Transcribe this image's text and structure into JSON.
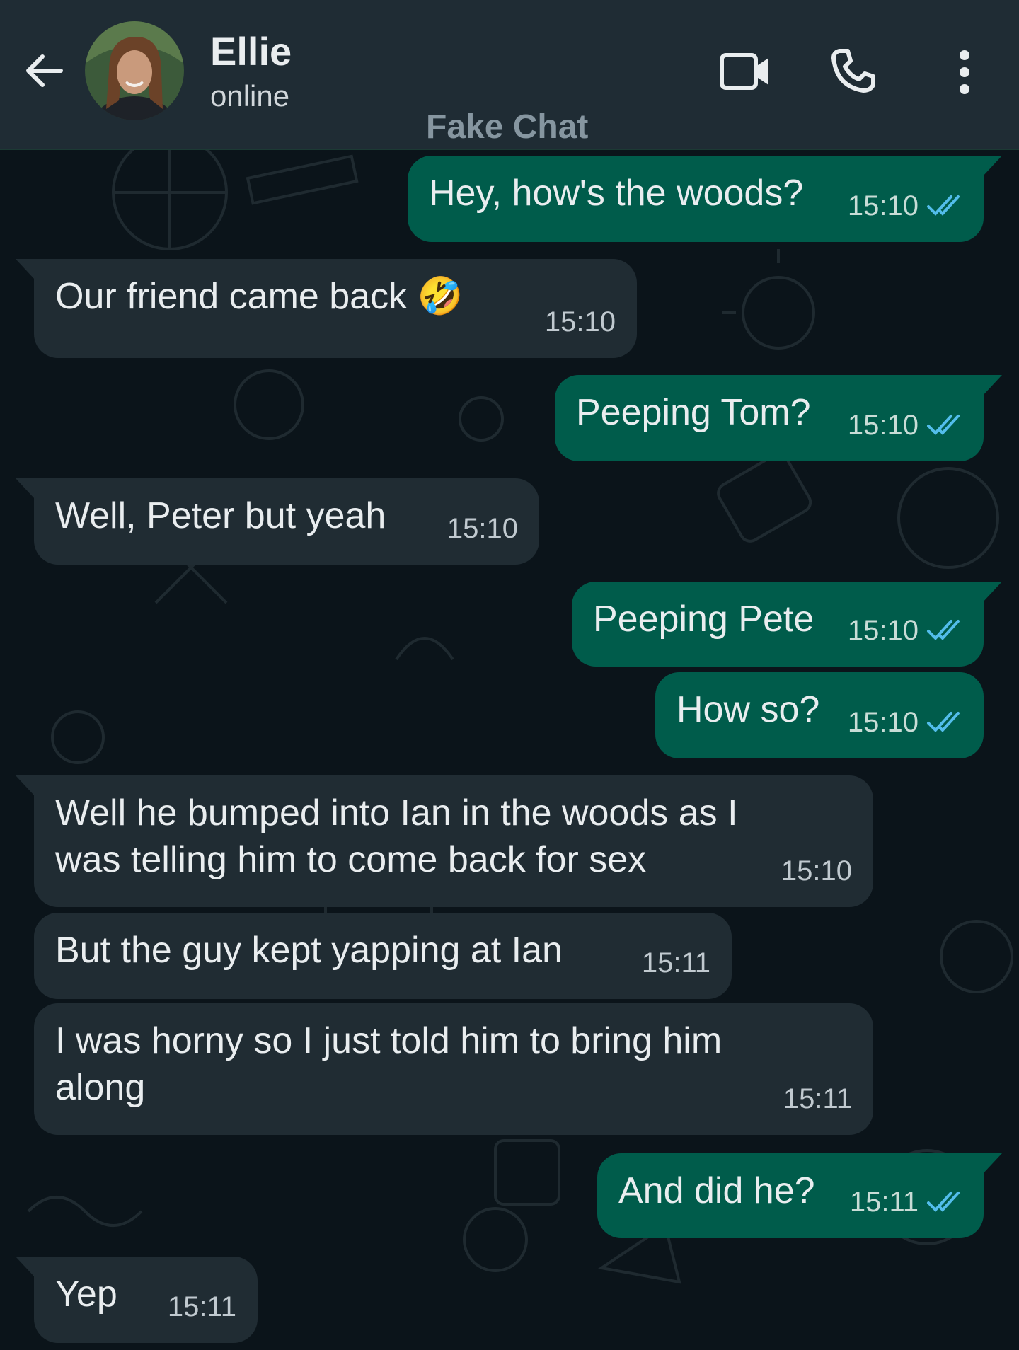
{
  "header": {
    "contact_name": "Ellie",
    "status": "online",
    "watermark": "Fake Chat",
    "icons": [
      "back-arrow-icon",
      "video-call-icon",
      "voice-call-icon",
      "more-options-icon"
    ]
  },
  "colors": {
    "header_bg": "#1f2c34",
    "chat_bg": "#0b141a",
    "incoming_bubble": "#202c33",
    "outgoing_bubble": "#005c4b",
    "read_ticks": "#53bdeb"
  },
  "messages": [
    {
      "dir": "out",
      "text": "Hey, how's the woods?",
      "time": "15:10",
      "read": true
    },
    {
      "dir": "in",
      "text": "Our friend came back 🤣",
      "time": "15:10"
    },
    {
      "dir": "out",
      "text": "Peeping Tom?",
      "time": "15:10",
      "read": true
    },
    {
      "dir": "in",
      "text": "Well, Peter but yeah",
      "time": "15:10"
    },
    {
      "dir": "out",
      "text": "Peeping Pete",
      "time": "15:10",
      "read": true
    },
    {
      "dir": "out",
      "text": "How so?",
      "time": "15:10",
      "read": true
    },
    {
      "dir": "in",
      "text": "Well he bumped into Ian in the woods as I was telling him to come back for sex",
      "time": "15:10"
    },
    {
      "dir": "in",
      "text": "But the guy kept yapping at Ian",
      "time": "15:11"
    },
    {
      "dir": "in",
      "text": "I was horny so I just told him to bring him along",
      "time": "15:11"
    },
    {
      "dir": "out",
      "text": "And did he?",
      "time": "15:11",
      "read": true
    },
    {
      "dir": "in",
      "text": "Yep",
      "time": "15:11"
    }
  ]
}
